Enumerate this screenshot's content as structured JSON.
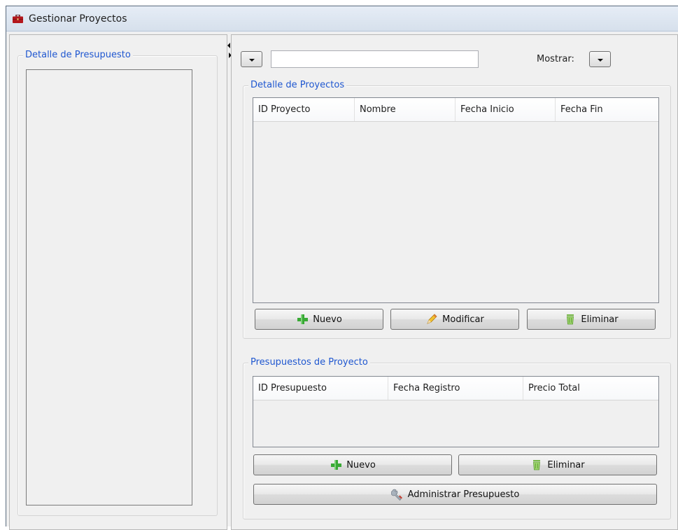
{
  "window": {
    "title": "Gestionar Proyectos",
    "icon": "briefcase-icon",
    "accent_color": "#1f57d0"
  },
  "left_panel": {
    "group_title": "Detalle de Presupuesto"
  },
  "toolbar": {
    "search_value": "",
    "mostrar_label": "Mostrar:"
  },
  "proyectos": {
    "group_title": "Detalle de Proyectos",
    "columns": [
      "ID Proyecto",
      "Nombre",
      "Fecha Inicio",
      "Fecha Fin"
    ],
    "rows": [],
    "buttons": {
      "nuevo": "Nuevo",
      "modificar": "Modificar",
      "eliminar": "Eliminar"
    }
  },
  "presupuestos": {
    "group_title": "Presupuestos de Proyecto",
    "columns": [
      "ID Presupuesto",
      "Fecha Registro",
      "Precio Total"
    ],
    "rows": [],
    "buttons": {
      "nuevo": "Nuevo",
      "eliminar": "Eliminar",
      "administrar": "Administrar Presupuesto"
    }
  }
}
